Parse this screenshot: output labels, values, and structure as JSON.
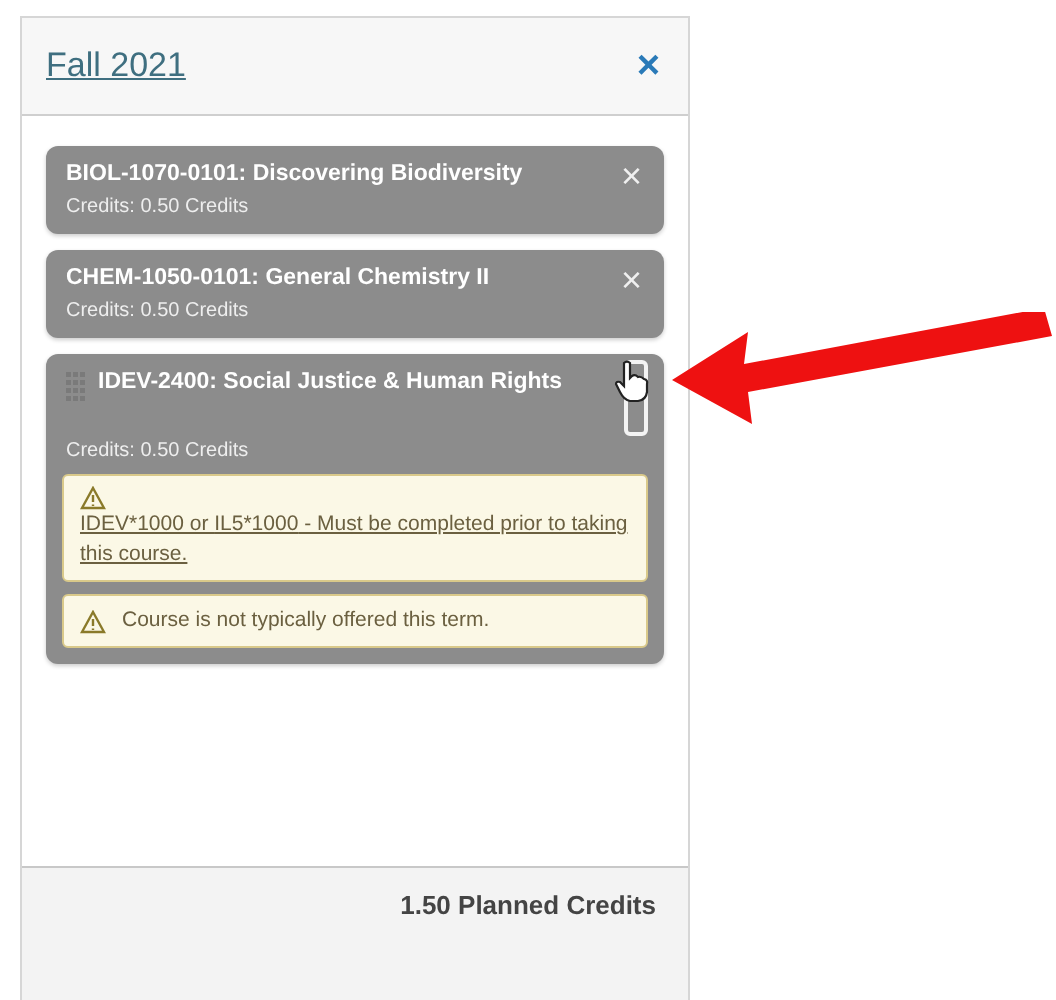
{
  "term": {
    "title": "Fall 2021",
    "close": "×"
  },
  "courses": [
    {
      "title": "BIOL-1070-0101: Discovering Biodiversity",
      "credits": "Credits: 0.50 Credits",
      "remove": "×",
      "hovered": false
    },
    {
      "title": "CHEM-1050-0101: General Chemistry II",
      "credits": "Credits: 0.50 Credits",
      "remove": "×",
      "hovered": false
    },
    {
      "title": "IDEV-2400: Social Justice & Human Rights",
      "credits": "Credits: 0.50 Credits",
      "hovered": true,
      "warnings": [
        {
          "kind": "requisite",
          "links": [
            "IDEV*1000",
            "IL5*1000"
          ],
          "joiner": "or",
          "text": "- Must be completed prior to taking this course."
        },
        {
          "kind": "note",
          "text": "Course is not typically offered this term."
        }
      ]
    }
  ],
  "footer": {
    "total": "1.50 Planned Credits"
  }
}
